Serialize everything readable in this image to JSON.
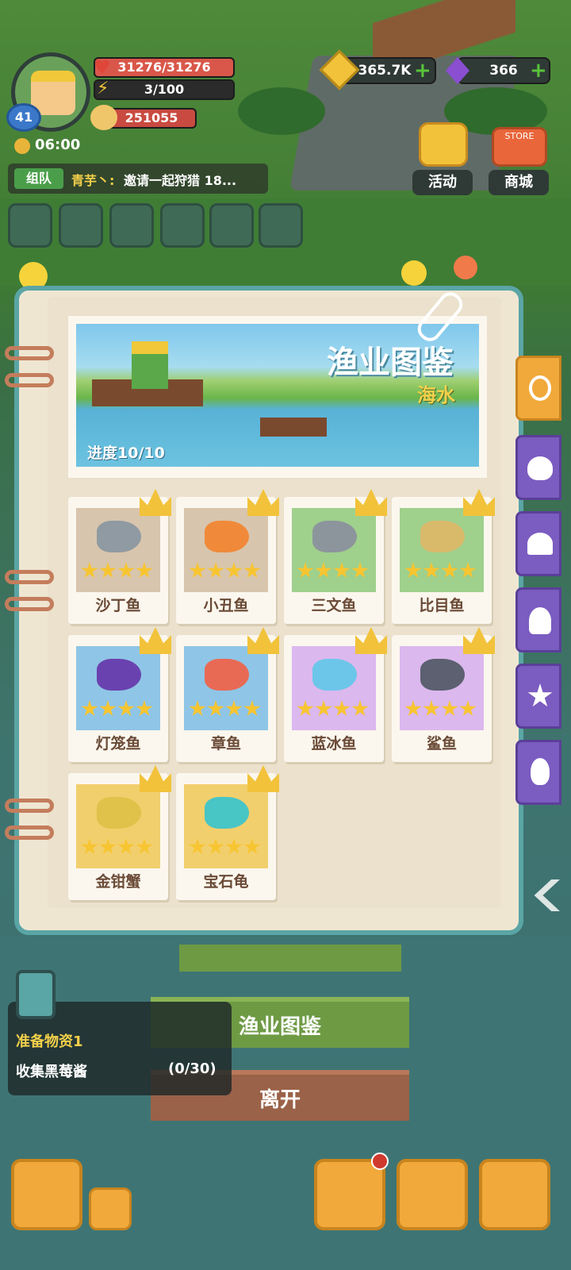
{
  "hud": {
    "level": "41",
    "hp": "31276/31276",
    "energy": "3/100",
    "power": "251055",
    "time": "06:00",
    "gold": "365.7K",
    "gems": "366",
    "plus": "+"
  },
  "chat": {
    "tag": "组队",
    "name": "青芋丶:",
    "message": "邀请一起狩猎 18..."
  },
  "top_buttons": {
    "activity": "活动",
    "shop": "商城",
    "store_sign": "STORE"
  },
  "book": {
    "title": "渔业图鉴",
    "subtitle": "海水",
    "progress": "进度10/10",
    "fish": [
      {
        "name": "沙丁鱼",
        "stars": 4,
        "bg": "#d8c5ad",
        "color": "#8f9aa2"
      },
      {
        "name": "小丑鱼",
        "stars": 4,
        "bg": "#d8c5ad",
        "color": "#f08a3a"
      },
      {
        "name": "三文鱼",
        "stars": 4,
        "bg": "#9fd08c",
        "color": "#8d959c"
      },
      {
        "name": "比目鱼",
        "stars": 4,
        "bg": "#9fd08c",
        "color": "#d9b96a"
      },
      {
        "name": "灯笼鱼",
        "stars": 4,
        "bg": "#8fc5e6",
        "color": "#6a42b0"
      },
      {
        "name": "章鱼",
        "stars": 4,
        "bg": "#8fc5e6",
        "color": "#e86a55"
      },
      {
        "name": "蓝冰鱼",
        "stars": 4,
        "bg": "#dbb8ee",
        "color": "#6cc6ea"
      },
      {
        "name": "鲨鱼",
        "stars": 4,
        "bg": "#dbb8ee",
        "color": "#5c6070"
      },
      {
        "name": "金钳蟹",
        "stars": 4,
        "bg": "#f2cf6d",
        "color": "#e0c24a"
      },
      {
        "name": "宝石龟",
        "stars": 4,
        "bg": "#f2cf6d",
        "color": "#48c5c5"
      }
    ]
  },
  "side_tabs": [
    "fish-tab",
    "conch-tab",
    "shell-tab",
    "octopus-tab",
    "starfish-tab",
    "fire-tab"
  ],
  "quest": {
    "title": "准备物资1",
    "task": "收集黑莓酱",
    "progress_partial": "(0/30)"
  },
  "menu": {
    "fishing_guide": "渔业图鉴",
    "leave": "离开"
  },
  "colors": {
    "hp_bar": "#d9574a",
    "gold": "#f2c23a",
    "gem": "#8a4fd0",
    "active_tab": "#f0a93a",
    "inactive_tab": "#7b5cc0"
  }
}
